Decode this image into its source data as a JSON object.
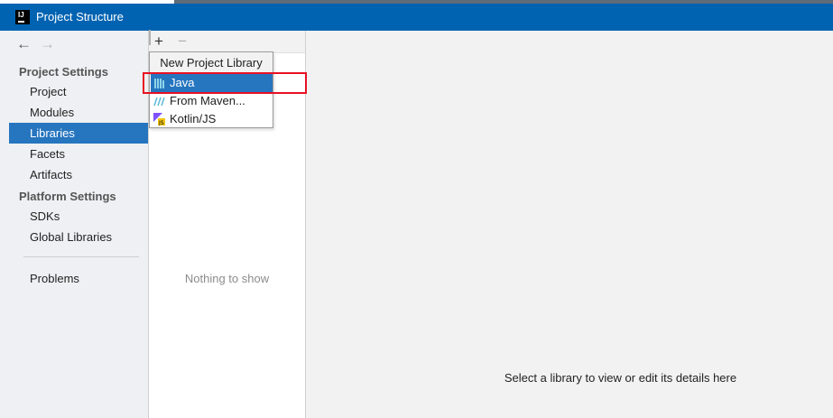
{
  "window": {
    "title": "Project Structure"
  },
  "nav": {
    "back_icon": "←",
    "forward_icon": "→"
  },
  "sidebar": {
    "sections": [
      {
        "header": "Project Settings",
        "items": [
          "Project",
          "Modules",
          "Libraries",
          "Facets",
          "Artifacts"
        ]
      },
      {
        "header": "Platform Settings",
        "items": [
          "SDKs",
          "Global Libraries"
        ]
      }
    ],
    "problems": "Problems",
    "selected": "Libraries"
  },
  "toolbar": {
    "add": "+",
    "remove": "−"
  },
  "library_list": {
    "empty_text": "Nothing to show"
  },
  "popup": {
    "title": "New Project Library",
    "items": [
      "Java",
      "From Maven...",
      "Kotlin/JS"
    ],
    "selected": "Java"
  },
  "details": {
    "empty_text": "Select a library to view or edit its details here"
  },
  "colors": {
    "titlebar": "#0063b1",
    "selection": "#2675bf",
    "highlight": "#e81123"
  }
}
